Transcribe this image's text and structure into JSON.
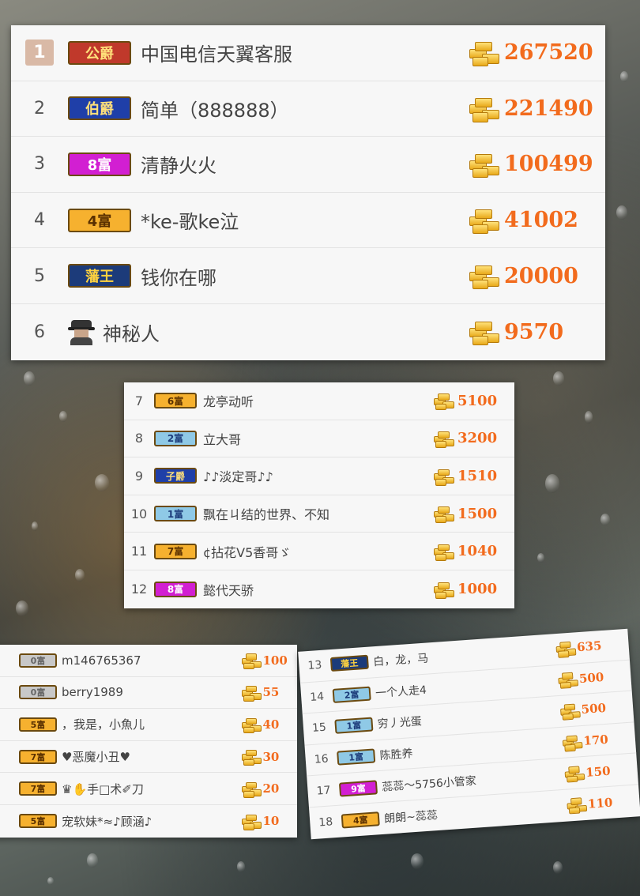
{
  "colors": {
    "amount": "#f26b1d",
    "rank1_bg": "#d9b9a6"
  },
  "card1": {
    "rows": [
      {
        "rank": "1",
        "badge": "公爵",
        "badge_color": "#c0392b",
        "badge_text": "#ffe07a",
        "name": "中国电信天翼客服",
        "amount": "267520"
      },
      {
        "rank": "2",
        "badge": "伯爵",
        "badge_color": "#1f3fa8",
        "badge_text": "#ffe07a",
        "name": "简单（888888）",
        "amount": "221490"
      },
      {
        "rank": "3",
        "badge": "8富",
        "badge_color": "#d21fd2",
        "badge_text": "#ffffff",
        "name": "清静火火",
        "amount": "100499"
      },
      {
        "rank": "4",
        "badge": "4富",
        "badge_color": "#f6b12f",
        "badge_text": "#5a3000",
        "name": "*ke-歌ke泣",
        "amount": "41002"
      },
      {
        "rank": "5",
        "badge": "藩王",
        "badge_color": "#1c3b7a",
        "badge_text": "#ffd23f",
        "name": "钱你在哪",
        "amount": "20000"
      },
      {
        "rank": "6",
        "badge": "",
        "badge_color": "",
        "badge_text": "",
        "name": "神秘人",
        "amount": "9570"
      }
    ]
  },
  "card2": {
    "rows": [
      {
        "rank": "7",
        "badge": "6富",
        "badge_color": "#f6b12f",
        "badge_text": "#5a3000",
        "name": "龙亭动听",
        "amount": "5100"
      },
      {
        "rank": "8",
        "badge": "2富",
        "badge_color": "#8fc9e6",
        "badge_text": "#1c3b7a",
        "name": "立大哥",
        "amount": "3200"
      },
      {
        "rank": "9",
        "badge": "子爵",
        "badge_color": "#1f3fa8",
        "badge_text": "#ffe07a",
        "name": "♪♪淡定哥♪♪",
        "amount": "1510"
      },
      {
        "rank": "10",
        "badge": "1富",
        "badge_color": "#8fc9e6",
        "badge_text": "#1c3b7a",
        "name": "飘在ㄐ结的世界、不知",
        "amount": "1500"
      },
      {
        "rank": "11",
        "badge": "7富",
        "badge_color": "#f6b12f",
        "badge_text": "#5a3000",
        "name": "¢拈花V5香哥ゞ",
        "amount": "1040"
      },
      {
        "rank": "12",
        "badge": "8富",
        "badge_color": "#d21fd2",
        "badge_text": "#ffffff",
        "name": "懿代天骄",
        "amount": "1000"
      }
    ]
  },
  "card3": {
    "rows": [
      {
        "rank": "",
        "badge": "0富",
        "badge_color": "#c8c8c8",
        "badge_text": "#666666",
        "name": "m146765367",
        "amount": "100"
      },
      {
        "rank": "",
        "badge": "0富",
        "badge_color": "#c8c8c8",
        "badge_text": "#666666",
        "name": "berry1989",
        "amount": "55"
      },
      {
        "rank": "",
        "badge": "5富",
        "badge_color": "#f6b12f",
        "badge_text": "#5a3000",
        "name": "，我是，小魚儿",
        "amount": "40"
      },
      {
        "rank": "",
        "badge": "7富",
        "badge_color": "#f6b12f",
        "badge_text": "#5a3000",
        "name": "♥恶魔小丑♥",
        "amount": "30"
      },
      {
        "rank": "",
        "badge": "7富",
        "badge_color": "#f6b12f",
        "badge_text": "#5a3000",
        "name": "♛✋手□术✐刀",
        "amount": "20"
      },
      {
        "rank": "",
        "badge": "5富",
        "badge_color": "#f6b12f",
        "badge_text": "#5a3000",
        "name": "宠软妹*≈♪顾涵♪",
        "amount": "10"
      }
    ]
  },
  "card4": {
    "rows": [
      {
        "rank": "13",
        "badge": "藩王",
        "badge_color": "#1c3b7a",
        "badge_text": "#ffd23f",
        "name": "白，龙，马",
        "amount": "635"
      },
      {
        "rank": "14",
        "badge": "2富",
        "badge_color": "#8fc9e6",
        "badge_text": "#1c3b7a",
        "name": "一个人走4",
        "amount": "500"
      },
      {
        "rank": "15",
        "badge": "1富",
        "badge_color": "#8fc9e6",
        "badge_text": "#1c3b7a",
        "name": "穷丿光蛋",
        "amount": "500"
      },
      {
        "rank": "16",
        "badge": "1富",
        "badge_color": "#8fc9e6",
        "badge_text": "#1c3b7a",
        "name": "陈胜养",
        "amount": "170"
      },
      {
        "rank": "17",
        "badge": "9富",
        "badge_color": "#d21fd2",
        "badge_text": "#ffffff",
        "name": "蕊蕊～5756小管家",
        "amount": "150"
      },
      {
        "rank": "18",
        "badge": "4富",
        "badge_color": "#f6b12f",
        "badge_text": "#5a3000",
        "name": "朗朗~蕊蕊",
        "amount": "110"
      }
    ]
  }
}
